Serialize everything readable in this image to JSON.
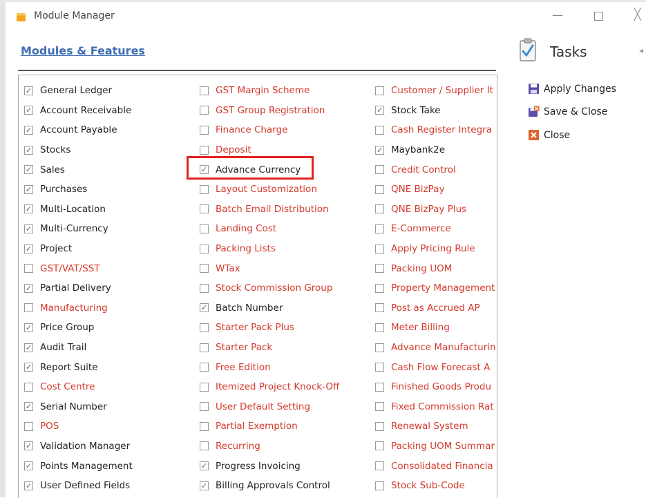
{
  "window": {
    "title": "Module Manager"
  },
  "header": {
    "title": "Modules & Features"
  },
  "tasks": {
    "title": "Tasks",
    "items": [
      {
        "label": "Apply Changes",
        "icon": "floppy-disk-icon"
      },
      {
        "label": "Save & Close",
        "icon": "save-close-icon"
      },
      {
        "label": "Close",
        "icon": "close-x-icon"
      }
    ]
  },
  "colors": {
    "enabled_label": "#222222",
    "disabled_label": "#d33a2c",
    "header_link": "#3f6fb6",
    "highlight_box": "#e32020"
  },
  "modules": {
    "col1": [
      {
        "label": "General Ledger",
        "checked": true
      },
      {
        "label": "Account Receivable",
        "checked": true
      },
      {
        "label": "Account Payable",
        "checked": true
      },
      {
        "label": "Stocks",
        "checked": true
      },
      {
        "label": "Sales",
        "checked": true
      },
      {
        "label": "Purchases",
        "checked": true
      },
      {
        "label": "Multi-Location",
        "checked": true
      },
      {
        "label": "Multi-Currency",
        "checked": true
      },
      {
        "label": "Project",
        "checked": true
      },
      {
        "label": "GST/VAT/SST",
        "checked": false
      },
      {
        "label": "Partial Delivery",
        "checked": true
      },
      {
        "label": "Manufacturing",
        "checked": false
      },
      {
        "label": "Price Group",
        "checked": true
      },
      {
        "label": "Audit Trail",
        "checked": true
      },
      {
        "label": "Report Suite",
        "checked": true
      },
      {
        "label": "Cost Centre",
        "checked": false
      },
      {
        "label": "Serial Number",
        "checked": true
      },
      {
        "label": "POS",
        "checked": false
      },
      {
        "label": "Validation Manager",
        "checked": true
      },
      {
        "label": "Points Management",
        "checked": true
      },
      {
        "label": "User Defined Fields",
        "checked": true
      }
    ],
    "col2": [
      {
        "label": "GST Margin Scheme",
        "checked": false
      },
      {
        "label": "GST Group Registration",
        "checked": false
      },
      {
        "label": "Finance Charge",
        "checked": false
      },
      {
        "label": "Deposit",
        "checked": false
      },
      {
        "label": "Advance Currency",
        "checked": true
      },
      {
        "label": "Layout Customization",
        "checked": false
      },
      {
        "label": "Batch Email Distribution",
        "checked": false
      },
      {
        "label": "Landing Cost",
        "checked": false
      },
      {
        "label": "Packing Lists",
        "checked": false
      },
      {
        "label": "WTax",
        "checked": false
      },
      {
        "label": "Stock Commission Group",
        "checked": false
      },
      {
        "label": "Batch Number",
        "checked": true
      },
      {
        "label": "Starter Pack Plus",
        "checked": false
      },
      {
        "label": "Starter Pack",
        "checked": false
      },
      {
        "label": "Free Edition",
        "checked": false
      },
      {
        "label": "Itemized Project Knock-Off",
        "checked": false
      },
      {
        "label": "User Default Setting",
        "checked": false
      },
      {
        "label": "Partial Exemption",
        "checked": false
      },
      {
        "label": "Recurring",
        "checked": false
      },
      {
        "label": "Progress Invoicing",
        "checked": true
      },
      {
        "label": "Billing Approvals Control",
        "checked": true
      }
    ],
    "col3": [
      {
        "label": "Customer / Supplier It",
        "checked": false
      },
      {
        "label": "Stock Take",
        "checked": true
      },
      {
        "label": "Cash Register Integra",
        "checked": false
      },
      {
        "label": "Maybank2e",
        "checked": true
      },
      {
        "label": "Credit Control",
        "checked": false
      },
      {
        "label": "QNE BizPay",
        "checked": false
      },
      {
        "label": "QNE BizPay Plus",
        "checked": false
      },
      {
        "label": "E-Commerce",
        "checked": false
      },
      {
        "label": "Apply Pricing Rule",
        "checked": false
      },
      {
        "label": "Packing UOM",
        "checked": false
      },
      {
        "label": "Property Management",
        "checked": false
      },
      {
        "label": "Post as Accrued AP",
        "checked": false
      },
      {
        "label": "Meter Billing",
        "checked": false
      },
      {
        "label": "Advance Manufacturin",
        "checked": false
      },
      {
        "label": "Cash Flow Forecast A",
        "checked": false
      },
      {
        "label": "Finished Goods Produ",
        "checked": false
      },
      {
        "label": "Fixed Commission Rat",
        "checked": false
      },
      {
        "label": "Renewal System",
        "checked": false
      },
      {
        "label": "Packing UOM Summar",
        "checked": false
      },
      {
        "label": "Consolidated Financia",
        "checked": false
      },
      {
        "label": "Stock Sub-Code",
        "checked": false
      }
    ]
  }
}
